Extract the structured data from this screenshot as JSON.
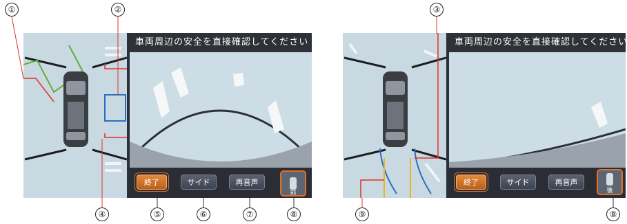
{
  "callouts": [
    "①",
    "②",
    "③",
    "④",
    "⑤",
    "⑥",
    "⑦",
    "⑧",
    "⑨",
    "⑧"
  ],
  "left_screen": {
    "message": "車両周辺の安全を直接確認してください",
    "buttons": {
      "end": "終了",
      "side": "サイド",
      "replay": "再音声"
    },
    "camera_view_icon": {
      "label": "前"
    }
  },
  "right_screen": {
    "message": "車両周辺の安全を直接確認してください",
    "buttons": {
      "end": "終了",
      "side": "サイド",
      "replay": "再音声"
    },
    "camera_view_icon": {
      "label": "後"
    }
  },
  "colors": {
    "active_button": "#d9742a",
    "callout_line": "#e0302a",
    "guide_green": "#5fae3e",
    "guide_blue": "#2a6fc2",
    "guide_yellow": "#e7b52a",
    "screen_bar": "#2e3136"
  }
}
